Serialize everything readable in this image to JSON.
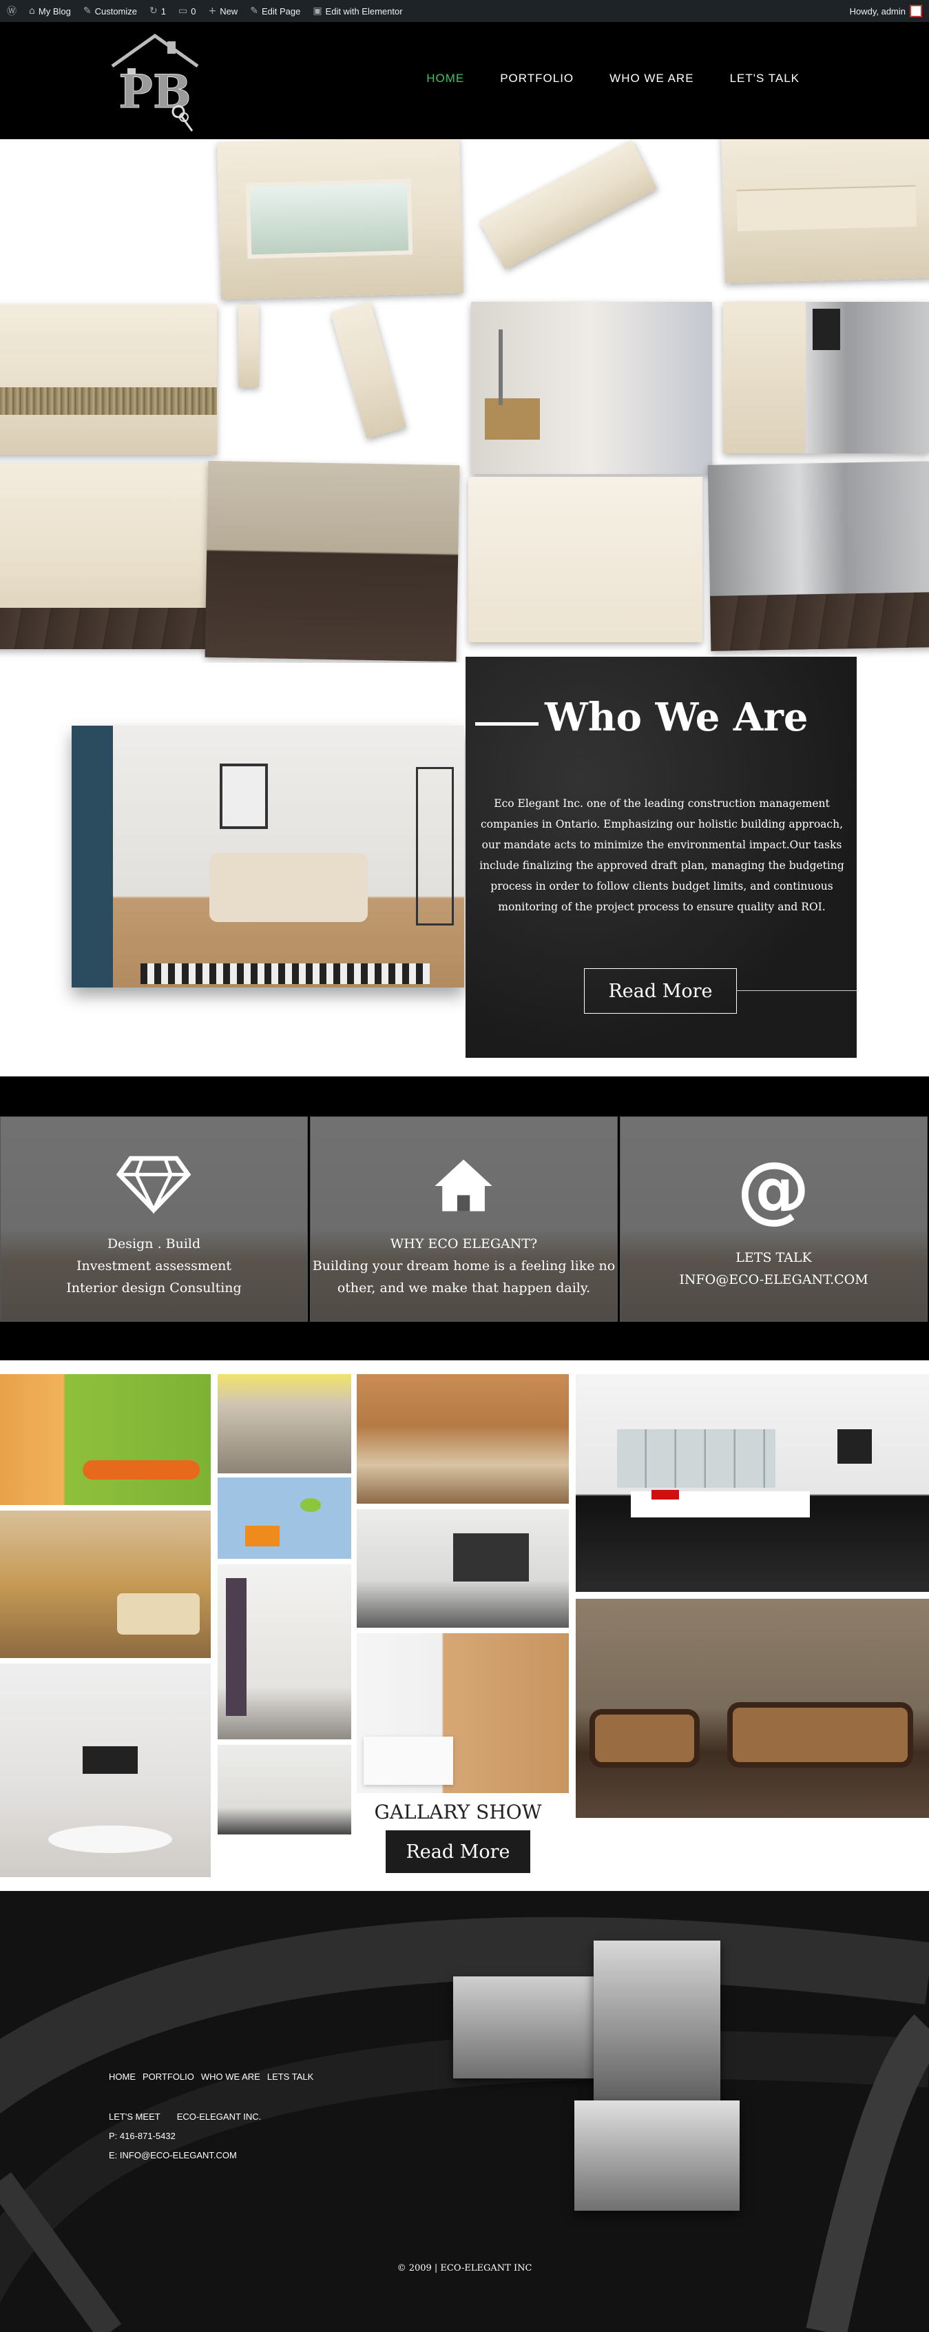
{
  "adminbar": {
    "items": [
      {
        "icon": "wordpress-icon",
        "label": ""
      },
      {
        "icon": "home-icon",
        "label": "My Blog"
      },
      {
        "icon": "brush-icon",
        "label": "Customize"
      },
      {
        "icon": "update-icon",
        "label": "1"
      },
      {
        "icon": "comment-icon",
        "label": "0"
      },
      {
        "icon": "plus-icon",
        "label": "New"
      },
      {
        "icon": "pencil-icon",
        "label": "Edit Page"
      },
      {
        "icon": "elementor-icon",
        "label": "Edit with Elementor"
      }
    ],
    "greeting": "Howdy, admin"
  },
  "header": {
    "logo_text": "PB",
    "nav": [
      "HOME",
      "PORTFOLIO",
      "WHO WE ARE",
      "LET'S TALK"
    ],
    "active_color": "#3ec45d"
  },
  "who": {
    "title": "Who We Are",
    "text": "Eco Elegant Inc. one of the leading construction management companies in Ontario. Emphasizing our holistic building approach, our mandate acts to minimize the environmental impact.Our tasks include finalizing the approved draft plan, managing the budgeting process in order to follow clients budget limits, and continuous monitoring of the project process to ensure quality and ROI.",
    "button": "Read More"
  },
  "features": [
    {
      "icon": "diamond-icon",
      "lines": [
        "Design . Build",
        "Investment assessment",
        "Interior design Consulting"
      ]
    },
    {
      "icon": "house-icon",
      "lines": [
        "WHY ECO ELEGANT?",
        "Building your dream home is a feeling like no",
        "other, and we make that happen daily."
      ]
    },
    {
      "icon": "at-icon",
      "lines": [
        "LETS TALK",
        "INFO@ECO-ELEGANT.COM"
      ]
    }
  ],
  "gallery": {
    "title": "GALLARY SHOW",
    "button": "Read More"
  },
  "footer": {
    "nav": [
      "HOME",
      "PORTFOLIO",
      "WHO WE ARE",
      "LETS TALK"
    ],
    "lets_meet": "LET'S MEET",
    "company": "ECO-ELEGANT INC.",
    "phone": "P: 416-871-5432",
    "email": "E: INFO@ECO-ELEGANT.COM",
    "copyright": "© 2009 | ECO-ELEGANT INC"
  }
}
